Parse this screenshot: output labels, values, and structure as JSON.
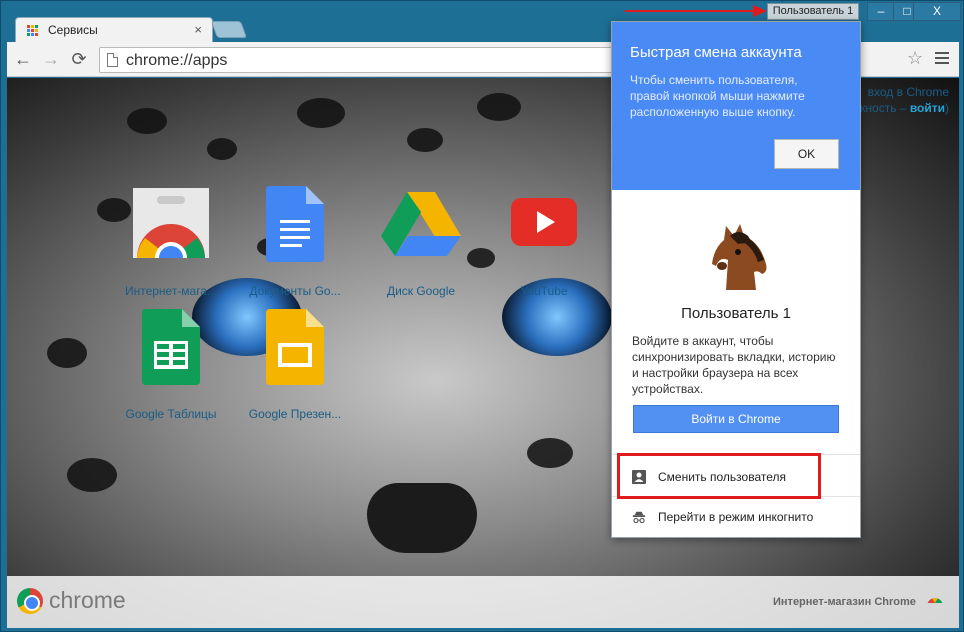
{
  "tab": {
    "label": "Сервисы",
    "close": "×",
    "icon": "apps-grid-icon"
  },
  "user_button": "Пользователь 1",
  "window_controls": {
    "minimize": "–",
    "maximize": "□",
    "close": "X"
  },
  "toolbar": {
    "back": "←",
    "forward": "→",
    "reload": "⟳",
    "url": "chrome://apps",
    "star": "☆"
  },
  "signin_hint": {
    "line1": "вход в Chrome",
    "line2_prefix": "кность –",
    "line2_link": "войти",
    "line2_suffix": ")"
  },
  "apps": [
    {
      "label": "Интернет-мага...",
      "icon": "web-store-icon"
    },
    {
      "label": "Документы Go...",
      "icon": "google-docs-icon"
    },
    {
      "label": "Диск Google",
      "icon": "google-drive-icon"
    },
    {
      "label": "YouTube",
      "icon": "youtube-icon"
    },
    {
      "label": "Google Таблицы",
      "icon": "google-sheets-icon"
    },
    {
      "label": "Google Презен...",
      "icon": "google-slides-icon"
    }
  ],
  "bottom": {
    "brand": "chrome",
    "store": "Интернет-магазин Chrome"
  },
  "popup": {
    "title": "Быстрая смена аккаунта",
    "description": "Чтобы сменить пользователя, правой кнопкой мыши нажмите расположенную выше кнопку.",
    "ok": "OK",
    "user_name": "Пользователь 1",
    "sync_text": "Войдите в аккаунт, чтобы синхронизировать вкладки, историю и настройки браузера на всех устройствах.",
    "signin_button": "Войти в Chrome",
    "switch_user": "Сменить пользователя",
    "incognito": "Перейти в режим инкогнито"
  },
  "colors": {
    "accent_blue": "#4a8af4",
    "annotation_red": "#e01b1b",
    "frame": "#1e6f96"
  }
}
